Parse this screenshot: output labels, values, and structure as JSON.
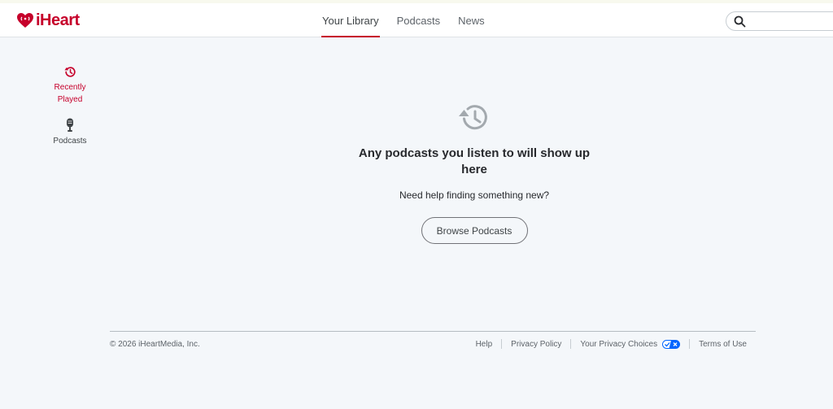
{
  "brand": {
    "logo_text": "iHeart",
    "accent_color": "#c6002b"
  },
  "nav": {
    "items": [
      {
        "label": "Your Library",
        "active": true
      },
      {
        "label": "Podcasts",
        "active": false
      },
      {
        "label": "News",
        "active": false
      }
    ]
  },
  "search": {
    "placeholder": "",
    "value": "",
    "icon": "search-icon"
  },
  "sidebar": {
    "items": [
      {
        "label": "Recently Played",
        "icon": "history-icon",
        "active": true
      },
      {
        "label": "Podcasts",
        "icon": "microphone-icon",
        "active": false
      }
    ]
  },
  "empty_state": {
    "icon": "history-icon",
    "heading": "Any podcasts you listen to will show up here",
    "subtext": "Need help finding something new?",
    "button_label": "Browse Podcasts"
  },
  "footer": {
    "copyright": "© 2026 iHeartMedia, Inc.",
    "links": [
      {
        "label": "Help"
      },
      {
        "label": "Privacy Policy"
      },
      {
        "label": "Your Privacy Choices",
        "icon": "privacy-choices-toggle-icon"
      },
      {
        "label": "Terms of Use"
      }
    ]
  }
}
